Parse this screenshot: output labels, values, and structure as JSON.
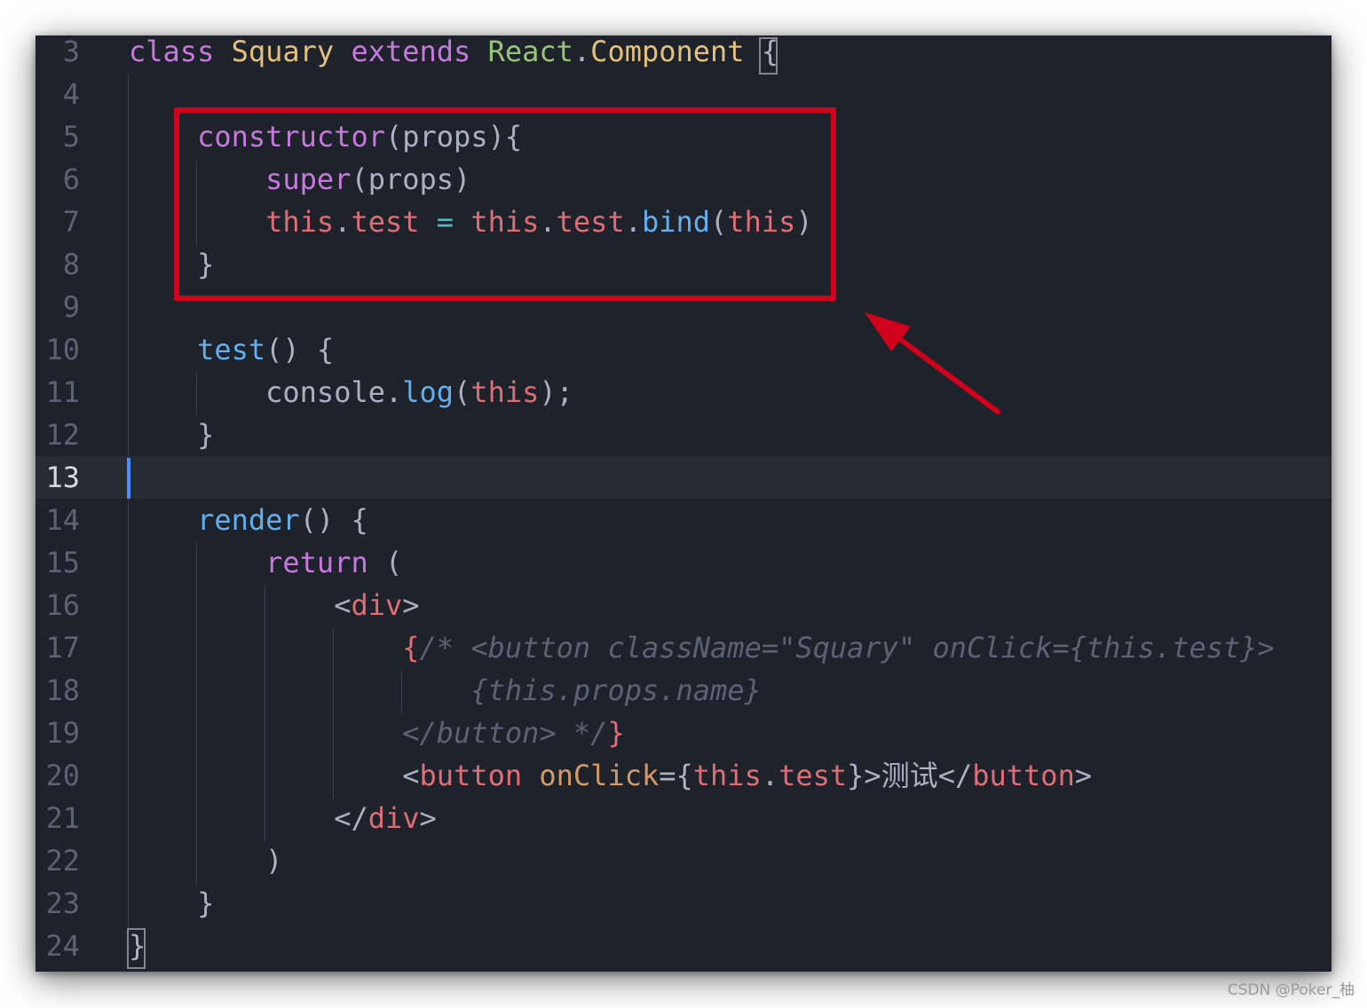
{
  "lines": [
    {
      "num": "3",
      "tokens": [
        {
          "t": "class",
          "c": "kw"
        },
        {
          "t": " ",
          "c": "pl"
        },
        {
          "t": "Squary",
          "c": "cls"
        },
        {
          "t": " ",
          "c": "pl"
        },
        {
          "t": "extends",
          "c": "kw"
        },
        {
          "t": " ",
          "c": "pl"
        },
        {
          "t": "React",
          "c": "cls2"
        },
        {
          "t": ".",
          "c": "pl"
        },
        {
          "t": "Component",
          "c": "cls"
        },
        {
          "t": " ",
          "c": "pl"
        },
        {
          "t": "{",
          "c": "pl"
        }
      ]
    },
    {
      "num": "4",
      "tokens": []
    },
    {
      "num": "5",
      "tokens": [
        {
          "t": "    ",
          "c": "pl"
        },
        {
          "t": "constructor",
          "c": "kw"
        },
        {
          "t": "(props){",
          "c": "pl"
        }
      ]
    },
    {
      "num": "6",
      "tokens": [
        {
          "t": "        ",
          "c": "pl"
        },
        {
          "t": "super",
          "c": "kw"
        },
        {
          "t": "(props)",
          "c": "pl"
        }
      ]
    },
    {
      "num": "7",
      "tokens": [
        {
          "t": "        ",
          "c": "pl"
        },
        {
          "t": "this",
          "c": "red"
        },
        {
          "t": ".",
          "c": "pl"
        },
        {
          "t": "test",
          "c": "red"
        },
        {
          "t": " ",
          "c": "pl"
        },
        {
          "t": "=",
          "c": "op"
        },
        {
          "t": " ",
          "c": "pl"
        },
        {
          "t": "this",
          "c": "red"
        },
        {
          "t": ".",
          "c": "pl"
        },
        {
          "t": "test",
          "c": "red"
        },
        {
          "t": ".",
          "c": "pl"
        },
        {
          "t": "bind",
          "c": "fn"
        },
        {
          "t": "(",
          "c": "pl"
        },
        {
          "t": "this",
          "c": "red"
        },
        {
          "t": ")",
          "c": "pl"
        }
      ]
    },
    {
      "num": "8",
      "tokens": [
        {
          "t": "    ",
          "c": "pl"
        },
        {
          "t": "}",
          "c": "pl"
        }
      ]
    },
    {
      "num": "9",
      "tokens": []
    },
    {
      "num": "10",
      "tokens": [
        {
          "t": "    ",
          "c": "pl"
        },
        {
          "t": "test",
          "c": "fn"
        },
        {
          "t": "() {",
          "c": "pl"
        }
      ]
    },
    {
      "num": "11",
      "tokens": [
        {
          "t": "        ",
          "c": "pl"
        },
        {
          "t": "console",
          "c": "pl"
        },
        {
          "t": ".",
          "c": "pl"
        },
        {
          "t": "log",
          "c": "fn"
        },
        {
          "t": "(",
          "c": "pl"
        },
        {
          "t": "this",
          "c": "red"
        },
        {
          "t": ");",
          "c": "pl"
        }
      ]
    },
    {
      "num": "12",
      "tokens": [
        {
          "t": "    ",
          "c": "pl"
        },
        {
          "t": "}",
          "c": "pl"
        }
      ]
    },
    {
      "num": "13",
      "tokens": [],
      "current": true
    },
    {
      "num": "14",
      "tokens": [
        {
          "t": "    ",
          "c": "pl"
        },
        {
          "t": "render",
          "c": "fn"
        },
        {
          "t": "() {",
          "c": "pl"
        }
      ]
    },
    {
      "num": "15",
      "tokens": [
        {
          "t": "        ",
          "c": "pl"
        },
        {
          "t": "return",
          "c": "kw"
        },
        {
          "t": " (",
          "c": "pl"
        }
      ]
    },
    {
      "num": "16",
      "tokens": [
        {
          "t": "            ",
          "c": "pl"
        },
        {
          "t": "<",
          "c": "pl"
        },
        {
          "t": "div",
          "c": "red"
        },
        {
          "t": ">",
          "c": "pl"
        }
      ]
    },
    {
      "num": "17",
      "tokens": [
        {
          "t": "                ",
          "c": "pl"
        },
        {
          "t": "{",
          "c": "br"
        },
        {
          "t": "/* <button className=\"Squary\" onClick={this.test}>",
          "c": "cm"
        }
      ]
    },
    {
      "num": "18",
      "tokens": [
        {
          "t": "                    ",
          "c": "pl"
        },
        {
          "t": "{this.props.name}",
          "c": "cm"
        }
      ]
    },
    {
      "num": "19",
      "tokens": [
        {
          "t": "                ",
          "c": "pl"
        },
        {
          "t": "</button> */",
          "c": "cm"
        },
        {
          "t": "}",
          "c": "br"
        }
      ]
    },
    {
      "num": "20",
      "tokens": [
        {
          "t": "                ",
          "c": "pl"
        },
        {
          "t": "<",
          "c": "pl"
        },
        {
          "t": "button",
          "c": "red"
        },
        {
          "t": " ",
          "c": "pl"
        },
        {
          "t": "onClick",
          "c": "attr"
        },
        {
          "t": "={",
          "c": "pl"
        },
        {
          "t": "this",
          "c": "red"
        },
        {
          "t": ".",
          "c": "pl"
        },
        {
          "t": "test",
          "c": "red"
        },
        {
          "t": "}>",
          "c": "pl"
        },
        {
          "t": "测试",
          "c": "tx"
        },
        {
          "t": "</",
          "c": "pl"
        },
        {
          "t": "button",
          "c": "red"
        },
        {
          "t": ">",
          "c": "pl"
        }
      ]
    },
    {
      "num": "21",
      "tokens": [
        {
          "t": "            ",
          "c": "pl"
        },
        {
          "t": "</",
          "c": "pl"
        },
        {
          "t": "div",
          "c": "red"
        },
        {
          "t": ">",
          "c": "pl"
        }
      ]
    },
    {
      "num": "22",
      "tokens": [
        {
          "t": "        ",
          "c": "pl"
        },
        {
          "t": ")",
          "c": "pl"
        }
      ]
    },
    {
      "num": "23",
      "tokens": [
        {
          "t": "    ",
          "c": "pl"
        },
        {
          "t": "}",
          "c": "pl"
        }
      ]
    },
    {
      "num": "24",
      "tokens": [
        {
          "t": "}",
          "c": "pl"
        }
      ]
    }
  ],
  "annotation": {
    "box_color": "#d0021b",
    "arrow_color": "#d0021b",
    "arrow_icon": "arrow-up-left-icon"
  },
  "watermark": "CSDN @Poker_柚"
}
